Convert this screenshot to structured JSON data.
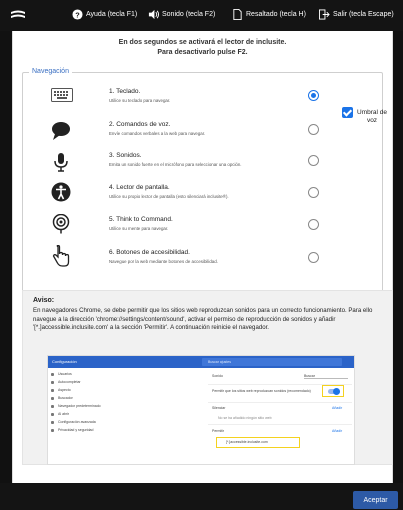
{
  "topbar": {
    "help_label": "Ayuda (tecla F1)",
    "sound_label": "Sonido (tecla F2)",
    "highlight_label": "Resaltado (tecla H)",
    "exit_label": "Salir (tecla Escape)"
  },
  "intro": {
    "line1": "En dos segundos se activará el lector de inclusite.",
    "line2": "Para desactivarlo pulse F2."
  },
  "navigation": {
    "legend": "Navegación",
    "options": [
      {
        "icon": "keyboard-icon",
        "title": "1. Teclado.",
        "desc": "Utilice su teclado para navegar.",
        "selected": true
      },
      {
        "icon": "speech-bubble-icon",
        "title": "2. Comandos de voz.",
        "desc": "Envíe comandos verbales a la web para navegar.",
        "selected": false
      },
      {
        "icon": "microphone-icon",
        "title": "3. Sonidos.",
        "desc": "Emita un sonido fuerte en el micrófono para seleccionar una opción.",
        "selected": false
      },
      {
        "icon": "accessibility-icon",
        "title": "4. Lector de pantalla.",
        "desc": "Utilice su propio lector de pantalla (esto silenciará inclusite®).",
        "selected": false
      },
      {
        "icon": "think-to-command-icon",
        "title": "5. Think to Command.",
        "desc": "Utilice su mente para navegar.",
        "selected": false
      },
      {
        "icon": "hand-pointer-icon",
        "title": "6. Botones de accesibilidad.",
        "desc": "Navegue por la web mediante botones de accesibilidad.",
        "selected": false
      }
    ],
    "threshold_label": "Umbral de voz",
    "threshold_checked": true
  },
  "notice": {
    "heading": "Aviso:",
    "text": "En navegadores Chrome, se debe permitir que los sitios web reproduzcan sonidos para un correcto funcionamiento. Para ello navegue a la dirección 'chrome://settings/content/sound', activar el permiso de reproducción de sonidos y añadir '[*.]accessible.inclusite.com' a la sección 'Permitir'. A continuación reinicie el navegador.",
    "screenshot": {
      "title": "Configuración",
      "search_placeholder": "Buscar ajustes",
      "nav": [
        "Usuarios",
        "Autocompletar",
        "Aspecto",
        "Buscador",
        "Navegador predeterminado",
        "Al abrir",
        "Configuración avanzada",
        "Privacidad y seguridad"
      ],
      "section": "Sonido",
      "search": "Buscar",
      "allow_label": "Permitir que los sitios web reproduzcan sonidos (recomendado)",
      "block_heading": "Silenciar",
      "block_empty": "No se ha añadido ningún sitio web",
      "allow_heading": "Permitir",
      "add_label": "Añadir",
      "allowed_site": "[*.]accessible.inclusite.com"
    }
  },
  "footer": {
    "accept_label": "Aceptar"
  },
  "colors": {
    "accent": "#1a73e8",
    "accept_button": "#2d5aa6",
    "legend": "#3a6fc2",
    "chrome_bar": "#2b63c8",
    "highlight": "#f4d21f"
  }
}
